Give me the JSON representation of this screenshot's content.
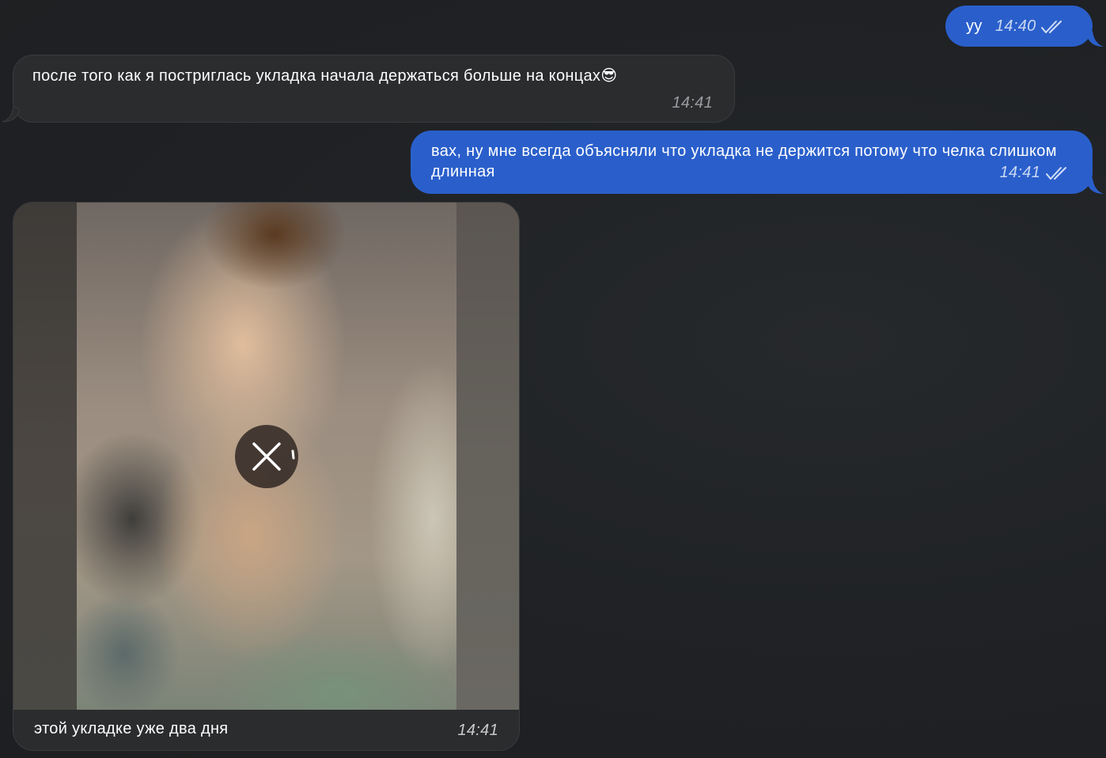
{
  "colors": {
    "background": "#1e2023",
    "outgoing_bubble": "#2a5fcb",
    "incoming_bubble": "#2b2c2e",
    "text": "#ffffff",
    "incoming_time": "#9a9ca0"
  },
  "messages": [
    {
      "direction": "outgoing",
      "text": "уу",
      "time": "14:40",
      "status_icon": "double-check-icon"
    },
    {
      "direction": "incoming",
      "text": "после того как я постриглась укладка начала держаться больше на концах",
      "emoji": "😎",
      "time": "14:41"
    },
    {
      "direction": "outgoing",
      "text": "вах, ну мне всегда объясняли что укладка не держится потому что челка слишком длинная",
      "time": "14:41",
      "status_icon": "double-check-icon"
    },
    {
      "direction": "incoming",
      "type": "media",
      "media_state": "loading",
      "media_control_icon": "close-icon",
      "caption": "этой укладке уже два дня",
      "time": "14:41"
    }
  ]
}
